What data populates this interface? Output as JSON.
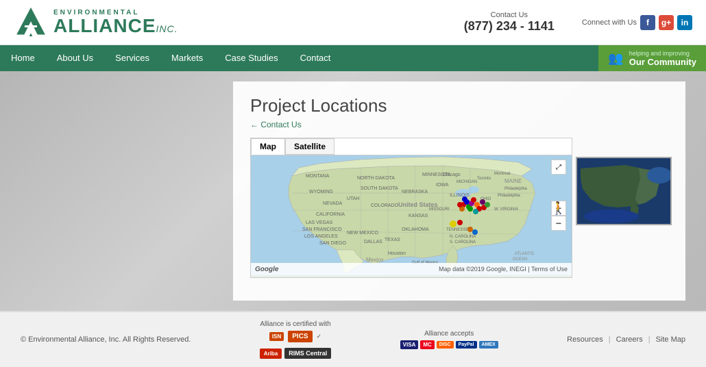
{
  "meta": {
    "title": "Environmental Alliance, Inc. - Project Locations"
  },
  "header": {
    "logo": {
      "environmental": "ENVIRONMENTAL",
      "alliance": "ALLIANCE",
      "inc": "INC."
    },
    "contact": {
      "label": "Contact Us",
      "phone": "(877) 234 - 1141"
    },
    "connect": {
      "label": "Connect with Us"
    },
    "social": [
      {
        "name": "Facebook",
        "code": "f",
        "class": "social-fb"
      },
      {
        "name": "Google+",
        "code": "g+",
        "class": "social-gp"
      },
      {
        "name": "LinkedIn",
        "code": "in",
        "class": "social-li"
      }
    ]
  },
  "nav": {
    "items": [
      {
        "label": "Home",
        "href": "#"
      },
      {
        "label": "About Us",
        "href": "#"
      },
      {
        "label": "Services",
        "href": "#"
      },
      {
        "label": "Markets",
        "href": "#"
      },
      {
        "label": "Case Studies",
        "href": "#"
      },
      {
        "label": "Contact",
        "href": "#"
      }
    ],
    "cta": {
      "helping": "helping and improving",
      "community": "Our Community"
    }
  },
  "main": {
    "title": "Project Locations",
    "breadcrumb": "Contact Us",
    "map": {
      "tab_map": "Map",
      "tab_satellite": "Satellite",
      "attribution": "Map data ©2019 Google, INEGI",
      "terms": "Terms of Use"
    }
  },
  "footer": {
    "copyright": "© Environmental Alliance, Inc. All Rights Reserved.",
    "certified_label": "Alliance is certified with",
    "accepts_label": "Alliance accepts",
    "links": [
      {
        "label": "Resources"
      },
      {
        "label": "Careers"
      },
      {
        "label": "Site Map"
      }
    ],
    "payment_methods": [
      "VISA",
      "MC",
      "DISC",
      "PayPal",
      "AMEX"
    ]
  },
  "icons": {
    "fullscreen": "⤢",
    "zoom_in": "+",
    "zoom_out": "−",
    "person": "🚶",
    "community_people": "👥"
  }
}
